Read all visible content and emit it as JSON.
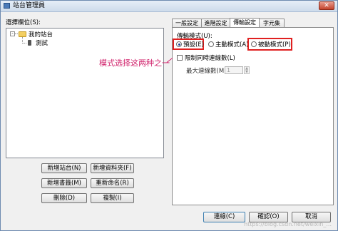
{
  "window": {
    "title": "站台管理員",
    "close_symbol": "✕"
  },
  "left": {
    "select_label": "選擇欄位(S):",
    "tree": {
      "root": "我的站台",
      "child": "測試",
      "expand_symbol": "-"
    }
  },
  "buttons": {
    "new_site": "新增站台(N)",
    "new_folder": "新增資料夾(F)",
    "new_bookmark": "新增書籤(M)",
    "rename": "重新命名(R)",
    "delete": "刪除(D)",
    "copy": "複製(I)",
    "connect": "連線(C)",
    "ok": "確認(O)",
    "cancel": "取消"
  },
  "tabs": [
    "一般設定",
    "進階設定",
    "傳輸設定",
    "字元集"
  ],
  "transfer": {
    "mode_label": "傳輸模式(U):",
    "mode_options": [
      "預設(E)",
      "主動模式(A)",
      "被動模式(P)"
    ],
    "limit_label": "限制同時連線數(L)",
    "max_label": "最大連線數(M):",
    "max_value": "1"
  },
  "annotation": {
    "text": "模式选择这两种之一"
  },
  "watermark": "https://blog.csdn.net/weixin_...",
  "colors": {
    "annotation": "#d0206a",
    "highlight_box": "#e02020",
    "selected_radio": "#1c3f94"
  }
}
